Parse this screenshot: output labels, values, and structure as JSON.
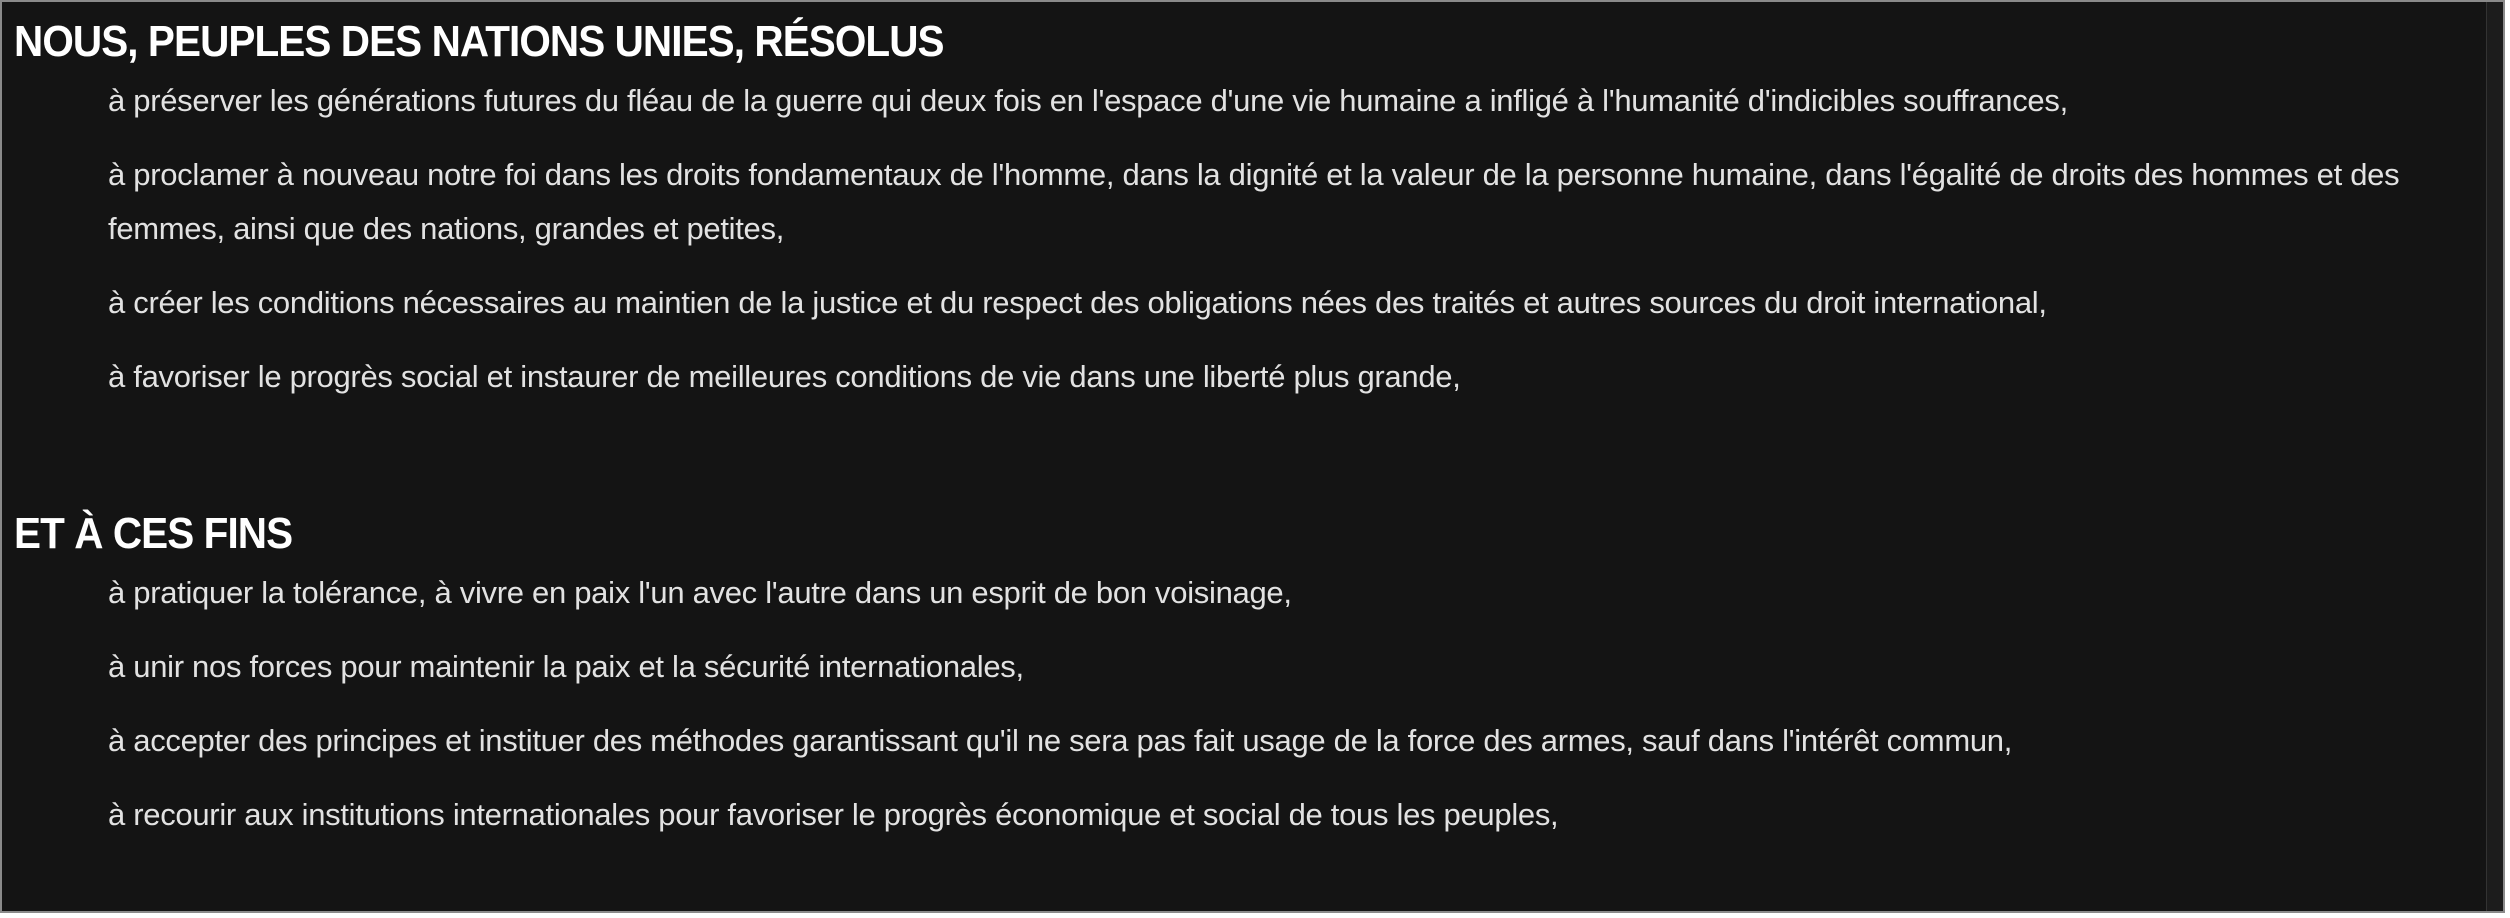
{
  "sections": [
    {
      "heading": "NOUS, PEUPLES DES NATIONS UNIES, RÉSOLUS",
      "clauses": [
        "à préserver les générations futures du fléau de la guerre qui deux fois en l'espace d'une vie humaine a infligé à l'humanité d'indicibles souffrances,",
        "à proclamer à nouveau notre foi dans les droits fondamentaux de l'homme, dans la dignité et la valeur de la personne humaine, dans l'égalité de droits des hommes et des femmes, ainsi que des nations, grandes et petites,",
        "à créer les conditions nécessaires au maintien de la justice et du respect des obligations nées des traités et autres sources du droit international,",
        "à favoriser le progrès social et instaurer de meilleures conditions de vie dans une liberté plus grande,"
      ]
    },
    {
      "heading": "ET À CES FINS",
      "clauses": [
        "à pratiquer la tolérance, à vivre en paix l'un avec l'autre dans un esprit de bon voisinage,",
        "à unir nos forces pour maintenir la paix et la sécurité internationales,",
        "à accepter des principes et instituer des méthodes garantissant qu'il ne sera pas fait usage de la force des armes, sauf dans l'intérêt commun,",
        "à recourir aux institutions internationales pour favoriser le progrès économique et social de tous les peuples,"
      ]
    }
  ],
  "colors": {
    "background": "#141414",
    "heading": "#ffffff",
    "text": "#e2e2e2",
    "border": "#8a8a8a"
  }
}
